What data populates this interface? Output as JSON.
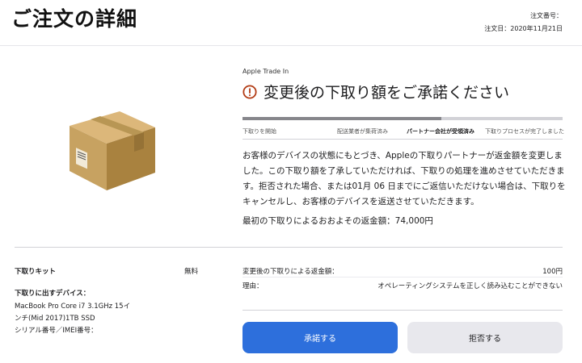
{
  "header": {
    "title": "ご注文の詳細",
    "order_number_label": "注文番号：",
    "order_date": "注文日：2020年11月21日"
  },
  "trade_in": {
    "eyebrow": "Apple Trade In",
    "headline": "変更後の下取り額をご承諾ください",
    "progress_fraction": 0.62,
    "steps": [
      {
        "label": "下取りを開始"
      },
      {
        "label": "配送業者が集荷済み"
      },
      {
        "label": "パートナー会社が受領済み"
      },
      {
        "label": "下取りプロセスが完了しました"
      }
    ],
    "body": "お客様のデバイスの状態にもとづき、Appleの下取りパートナーが返金額を変更しました。この下取り額を了承していただければ、下取りの処理を進めさせていただきます。拒否された場合、または01月 06 日までにご返信いただけない場合は、下取りをキャンセルし、お客様のデバイスを返送させていただきます。",
    "estimate": "最初の下取りによるおおよその返金額：74,000円"
  },
  "details": {
    "kit_label": "下取りキット",
    "kit_value": "無料",
    "device_label": "下取りに出すデバイス：",
    "device_lines": [
      "MacBook Pro Core i7 3.1GHz 15イ",
      "ンチ(Mid 2017)1TB SSD",
      "シリアル番号／IMEI番号："
    ],
    "new_amount_label": "変更後の下取りによる返金額：",
    "new_amount_value": "100円",
    "reason_label": "理由：",
    "reason_value": "オペレーティングシステムを正しく読み込むことができない"
  },
  "actions": {
    "accept": "承諾する",
    "decline": "拒否する"
  },
  "colors": {
    "accent": "#2d6fdc",
    "warning": "#b23b14",
    "box": "#c8a25f"
  }
}
